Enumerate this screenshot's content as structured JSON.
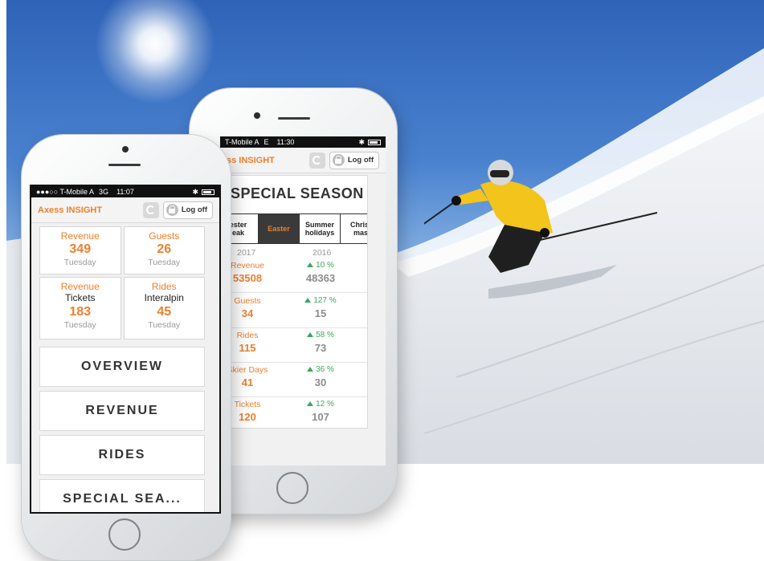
{
  "colors": {
    "accent": "#ee7f2d",
    "positive": "#3ea85b",
    "muted": "#9a9a9a"
  },
  "back_phone": {
    "status": {
      "carrier": "T-Mobile A",
      "network": "E",
      "time": "11:30"
    },
    "app": {
      "brand": "ss INSIGHT",
      "logoff_label": "Log off"
    },
    "card_title": "SPECIAL SEASON",
    "tabs": [
      {
        "label": "ester\neak"
      },
      {
        "label": "Easter"
      },
      {
        "label": "Summer\nholidays"
      },
      {
        "label": "Christ\nmas"
      }
    ],
    "years": {
      "current": "2017",
      "previous": "2016"
    },
    "stats": [
      {
        "label": "Revenue",
        "value": "53508",
        "change": "10 %",
        "previous": "48363"
      },
      {
        "label": "Guests",
        "value": "34",
        "change": "127 %",
        "previous": "15"
      },
      {
        "label": "Rides",
        "value": "115",
        "change": "58 %",
        "previous": "73"
      },
      {
        "label": "Skier Days",
        "value": "41",
        "change": "36 %",
        "previous": "30"
      },
      {
        "label": "Tickets",
        "value": "120",
        "change": "12 %",
        "previous": "107"
      }
    ]
  },
  "front_phone": {
    "status": {
      "carrier": "●●●○○ T-Mobile A",
      "network": "3G",
      "time": "11:07"
    },
    "app": {
      "brand": "Axess INSIGHT",
      "logoff_label": "Log off"
    },
    "kpis": [
      {
        "label": "Revenue",
        "sub": "",
        "value": "349",
        "day": "Tuesday"
      },
      {
        "label": "Guests",
        "sub": "",
        "value": "26",
        "day": "Tuesday"
      },
      {
        "label": "Revenue",
        "sub": "Tickets",
        "value": "183",
        "day": "Tuesday"
      },
      {
        "label": "Rides",
        "sub": "Interalpin",
        "value": "45",
        "day": "Tuesday"
      }
    ],
    "menu": [
      {
        "label": "OVERVIEW"
      },
      {
        "label": "REVENUE"
      },
      {
        "label": "RIDES"
      },
      {
        "label": "SPECIAL SEA..."
      }
    ]
  }
}
